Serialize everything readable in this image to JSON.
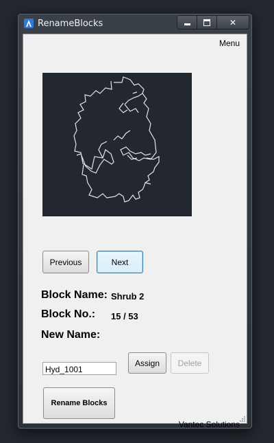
{
  "window": {
    "title": "RenameBlocks",
    "icon": "autocad-a-icon"
  },
  "menu": {
    "label": "Menu"
  },
  "preview": {
    "background": "#232830",
    "stroke": "#e6e6e6"
  },
  "nav": {
    "previous_label": "Previous",
    "next_label": "Next"
  },
  "info": {
    "block_name_label": "Block Name:",
    "block_name_value": "Shrub 2",
    "block_no_label": "Block No.:",
    "block_no_value": "15 / 53",
    "new_name_label": "New Name:"
  },
  "new_name_input": {
    "value": "Hyd_1001"
  },
  "actions": {
    "assign_label": "Assign",
    "delete_label": "Delete",
    "rename_label": "Rename Blocks"
  },
  "footer": {
    "company": "Vantec Solutions"
  }
}
